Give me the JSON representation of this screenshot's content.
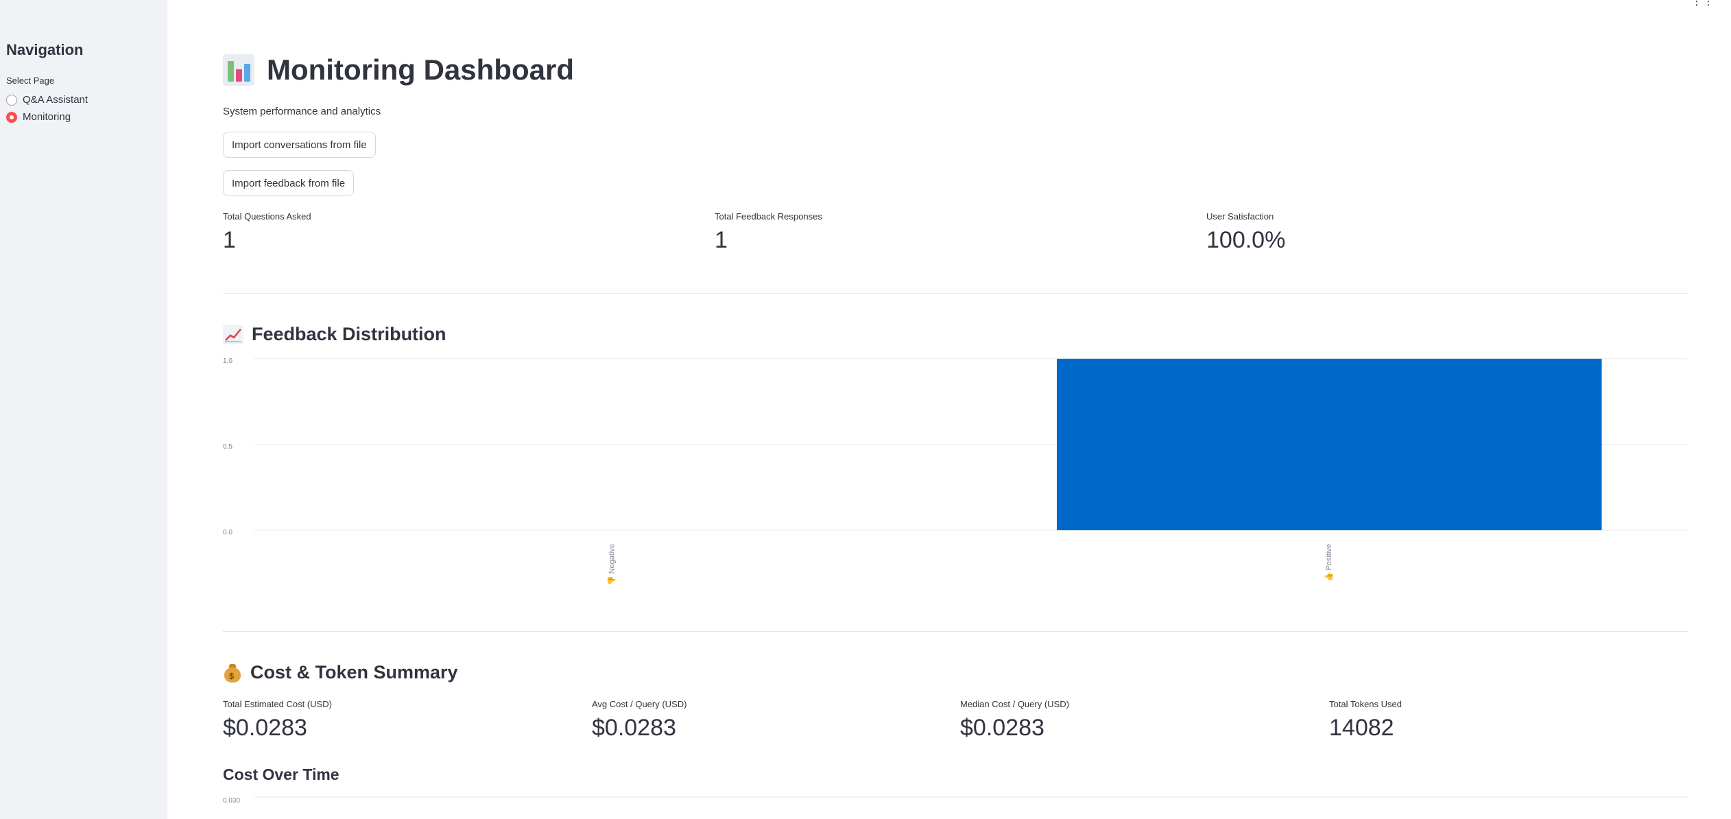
{
  "sidebar": {
    "title": "Navigation",
    "select_label": "Select Page",
    "options": [
      {
        "label": "Q&A Assistant",
        "selected": false
      },
      {
        "label": "Monitoring",
        "selected": true
      }
    ]
  },
  "header": {
    "title": "Monitoring Dashboard",
    "title_icon": "bar-chart-emoji",
    "subtitle": "System performance and analytics"
  },
  "buttons": {
    "import_conversations": "Import conversations from file",
    "import_feedback": "Import feedback from file"
  },
  "metrics": [
    {
      "label": "Total Questions Asked",
      "value": "1"
    },
    {
      "label": "Total Feedback Responses",
      "value": "1"
    },
    {
      "label": "User Satisfaction",
      "value": "100.0%"
    }
  ],
  "feedback_section": {
    "title": "Feedback Distribution",
    "icon": "chart-increasing-emoji"
  },
  "chart_data": {
    "type": "bar",
    "categories": [
      "👎 Negative",
      "👍 Positive"
    ],
    "values": [
      0,
      1
    ],
    "ylim": [
      0,
      1
    ],
    "yticks": [
      "0.0",
      "0.5",
      "1.0"
    ],
    "bar_color": "#0068c9",
    "grid": true
  },
  "cost_section": {
    "title": "Cost & Token Summary",
    "icon": "money-bag-emoji",
    "metrics": [
      {
        "label": "Total Estimated Cost (USD)",
        "value": "$0.0283"
      },
      {
        "label": "Avg Cost / Query (USD)",
        "value": "$0.0283"
      },
      {
        "label": "Median Cost / Query (USD)",
        "value": "$0.0283"
      },
      {
        "label": "Total Tokens Used",
        "value": "14082"
      }
    ],
    "cost_over_time_title": "Cost Over Time",
    "cost_over_time_top_tick": "0.030"
  },
  "colors": {
    "accent": "#ff4b4b",
    "sidebar_bg": "#f0f2f6",
    "bar": "#0068c9"
  }
}
